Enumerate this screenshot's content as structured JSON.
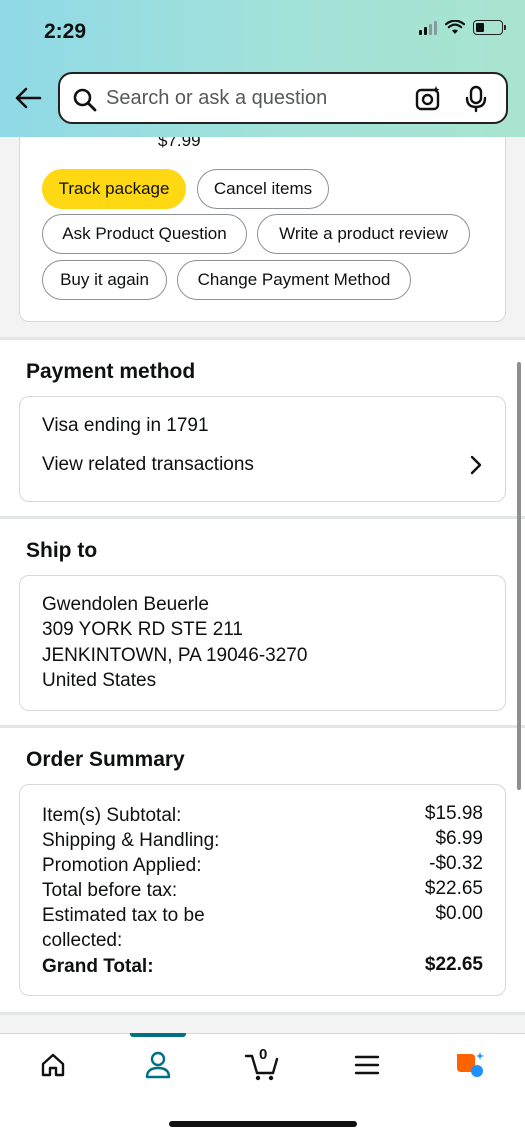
{
  "status": {
    "time": "2:29"
  },
  "search": {
    "placeholder": "Search or ask a question"
  },
  "order_card": {
    "price_peek": "$7.99",
    "buttons": {
      "track": "Track package",
      "cancel": "Cancel items",
      "ask": "Ask Product Question",
      "review": "Write a product review",
      "buy_again": "Buy it again",
      "change_payment": "Change Payment Method"
    }
  },
  "payment": {
    "title": "Payment method",
    "card": "Visa  ending in 1791",
    "related": "View related transactions"
  },
  "ship_to": {
    "title": "Ship to",
    "name": "Gwendolen Beuerle",
    "street": "309 YORK RD STE 211",
    "city": "JENKINTOWN, PA 19046-3270",
    "country": "United States"
  },
  "summary": {
    "title": "Order Summary",
    "rows": [
      {
        "label": "Item(s) Subtotal:",
        "value": "$15.98"
      },
      {
        "label": "Shipping & Handling:",
        "value": "$6.99"
      },
      {
        "label": "Promotion Applied:",
        "value": "-$0.32"
      },
      {
        "label": "Total before tax:",
        "value": "$22.65"
      },
      {
        "label": "Estimated tax to be collected:",
        "value": "$0.00"
      },
      {
        "label": "Grand Total:",
        "value": "$22.65"
      }
    ]
  },
  "nav": {
    "cart_count": "0",
    "icons": [
      "home-icon",
      "account-icon",
      "cart-icon",
      "menu-icon",
      "rufus-icon"
    ],
    "accent": "#007185"
  },
  "colors": {
    "primary_button": "#ffd814",
    "rufus_orange": "#ff6200",
    "rufus_blue": "#1e90ff"
  }
}
